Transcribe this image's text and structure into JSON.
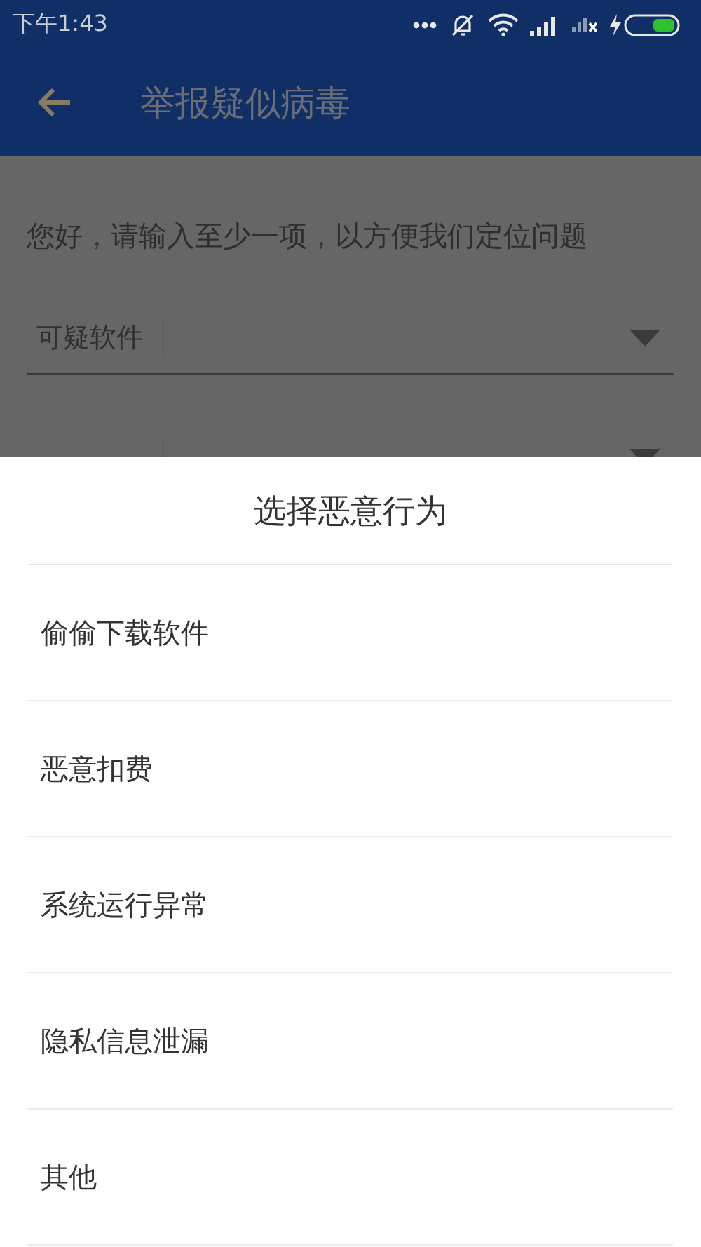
{
  "status_bar": {
    "time": "下午1:43"
  },
  "app_bar": {
    "title": "举报疑似病毒"
  },
  "form": {
    "intro": "您好，请输入至少一项，以方便我们定位问题",
    "fields": [
      {
        "kind": "dropdown",
        "label": "可疑软件"
      },
      {
        "kind": "dropdown"
      }
    ]
  },
  "sheet": {
    "title": "选择恶意行为",
    "options": [
      "偷偷下载软件",
      "恶意扣费",
      "系统运行异常",
      "隐私信息泄漏",
      "其他"
    ]
  }
}
